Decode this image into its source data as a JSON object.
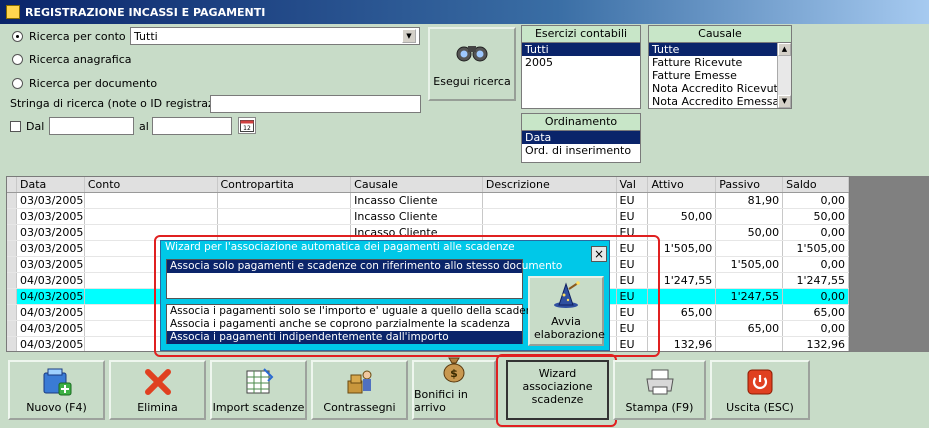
{
  "window": {
    "title": "REGISTRAZIONE INCASSI E PAGAMENTI"
  },
  "search": {
    "by_account_label": "Ricerca per conto",
    "account_value": "Tutti",
    "by_registry_label": "Ricerca anagrafica",
    "by_document_label": "Ricerca per documento",
    "string_label": "Stringa di ricerca (note o ID registrazione)",
    "string_value": "",
    "from_label": "Dal",
    "to_label": "al",
    "from_value": "",
    "to_value": "",
    "run_label": "Esegui ricerca"
  },
  "fiscal_years": {
    "header": "Esercizi contabili",
    "items": [
      "Tutti",
      "2005"
    ],
    "selected": 0
  },
  "causale": {
    "header": "Causale",
    "items": [
      "Tutte",
      "Fatture Ricevute",
      "Fatture Emesse",
      "Nota Accredito Ricevuta",
      "Nota Accredito Emessa"
    ],
    "selected": 0
  },
  "ordering": {
    "header": "Ordinamento",
    "items": [
      "Data",
      "Ord. di inserimento"
    ],
    "selected": 0
  },
  "grid": {
    "columns": [
      "Data",
      "Conto",
      "Contropartita",
      "Causale",
      "Descrizione",
      "Val",
      "Attivo",
      "Passivo",
      "Saldo"
    ],
    "rows": [
      [
        "03/03/2005",
        "",
        "",
        "Incasso Cliente",
        "",
        "EU",
        "",
        "81,90",
        "0,00"
      ],
      [
        "03/03/2005",
        "",
        "",
        "Incasso Cliente",
        "",
        "EU",
        "50,00",
        "",
        "50,00"
      ],
      [
        "03/03/2005",
        "",
        "",
        "Incasso Cliente",
        "",
        "EU",
        "",
        "50,00",
        "0,00"
      ],
      [
        "03/03/2005",
        "",
        "",
        "",
        "",
        "EU",
        "1'505,00",
        "",
        "1'505,00"
      ],
      [
        "03/03/2005",
        "",
        "",
        "",
        "",
        "EU",
        "",
        "1'505,00",
        "0,00"
      ],
      [
        "04/03/2005",
        "",
        "",
        "",
        "",
        "EU",
        "1'247,55",
        "",
        "1'247,55"
      ],
      [
        "04/03/2005",
        "",
        "",
        "",
        "",
        "EU",
        "",
        "1'247,55",
        "0,00"
      ],
      [
        "04/03/2005",
        "",
        "",
        "",
        "",
        "EU",
        "65,00",
        "",
        "65,00"
      ],
      [
        "04/03/2005",
        "",
        "",
        "",
        "",
        "EU",
        "",
        "65,00",
        "0,00"
      ],
      [
        "04/03/2005",
        "",
        "",
        "",
        "",
        "EU",
        "132,96",
        "",
        "132,96"
      ]
    ],
    "selected_row": 6
  },
  "wizard_panel": {
    "title": "Wizard per l'associazione automatica dei pagamenti alle scadenze",
    "top_option": "Associa solo pagamenti e scadenze con riferimento allo stesso documento",
    "options": [
      "Associa i pagamenti solo se l'importo e' uguale a quello della scadenza",
      "Associa i pagamenti anche se coprono parzialmente la scadenza",
      "Associa i pagamenti indipendentemente dall'importo"
    ],
    "selected_option": 2,
    "run_label": "Avvia elaborazione"
  },
  "toolbar": {
    "new": "Nuovo (F4)",
    "delete": "Elimina",
    "import": "Import scadenze",
    "cod": "Contrassegni",
    "transfers": "Bonifici in arrivo",
    "wizard": "Wizard associazione scadenze",
    "print": "Stampa (F9)",
    "exit": "Uscita (ESC)"
  },
  "colors": {
    "accent": "#0a246a",
    "highlight_row": "#00ffff",
    "wizard_bg": "#00c8e8",
    "callout": "#e02020"
  }
}
